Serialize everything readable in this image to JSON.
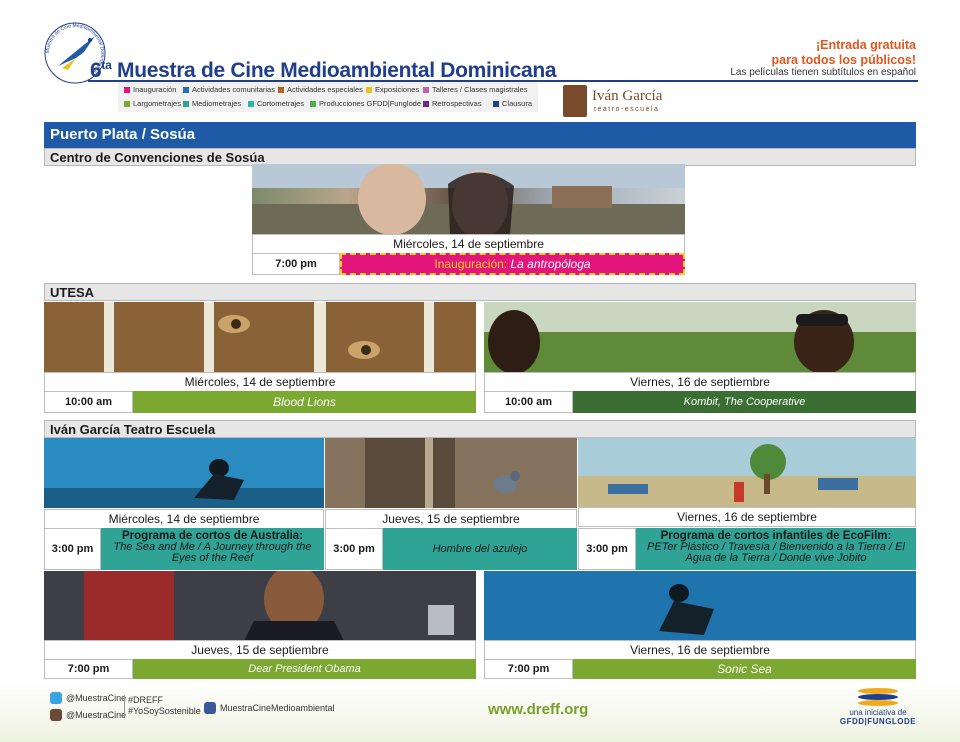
{
  "header": {
    "edition": "6",
    "edition_suffix": "ta",
    "title": "Muestra de Cine Medioambiental Dominicana",
    "logo_ring_text": "Muestra de Cine Medioambiental Dominicana",
    "free_entry_line1": "¡Entrada gratuita",
    "free_entry_line2": "para todos los públicos!",
    "subtitles_note": "Las películas tienen subtítulos en español",
    "legend": [
      {
        "label": "Inauguración",
        "color": "#e4147d"
      },
      {
        "label": "Actividades comunitarias",
        "color": "#2a6fb5"
      },
      {
        "label": "Actividades especiales",
        "color": "#b5651d"
      },
      {
        "label": "Exposiciones",
        "color": "#e8c21a"
      },
      {
        "label": "Talleres / Clases magistrales",
        "color": "#c060b0"
      },
      {
        "label": "Largometrajes",
        "color": "#7aa830"
      },
      {
        "label": "Mediometrajes",
        "color": "#2fa396"
      },
      {
        "label": "Cortometrajes",
        "color": "#27b7b0"
      },
      {
        "label": "Producciones GFDD|Funglode",
        "color": "#4db04a"
      },
      {
        "label": "Retrospectivas",
        "color": "#6a2a8a"
      },
      {
        "label": "Clausura",
        "color": "#1f3e8c"
      }
    ],
    "partner_name": "Iván García",
    "partner_sub": "teatro-escuela"
  },
  "region": {
    "title": "Puerto Plata / Sosúa"
  },
  "venues": {
    "sosua": {
      "name": "Centro de Convenciones de Sosúa",
      "event": {
        "date": "Miércoles, 14 de septiembre",
        "time": "7:00 pm",
        "label": "Inauguración:",
        "film": "La antropóloga"
      }
    },
    "utesa": {
      "name": "UTESA",
      "events": [
        {
          "date": "Miércoles, 14 de septiembre",
          "time": "10:00 am",
          "film": "Blood Lions"
        },
        {
          "date": "Viernes, 16 de septiembre",
          "time": "10:00 am",
          "film": "Kombit, The Cooperative"
        }
      ]
    },
    "ivan": {
      "name": "Iván García Teatro Escuela",
      "row1": [
        {
          "date": "Miércoles, 14 de septiembre",
          "time": "3:00 pm",
          "program": "Programa de cortos de Australia",
          "films": "The Sea and Me / A Journey through the Eyes of the Reef"
        },
        {
          "date": "Jueves, 15 de septiembre",
          "time": "3:00 pm",
          "film": "Hombre del azulejo"
        },
        {
          "date": "Viernes, 16 de septiembre",
          "time": "3:00 pm",
          "program": "Programa de cortos infantiles de EcoFilm:",
          "films": "PETer Plástico /  Travesía / Bienvenido a la Tierra /  El Agua de la Tierra / Donde vive Jobito"
        }
      ],
      "row2": [
        {
          "date": "Jueves, 15 de septiembre",
          "time": "7:00 pm",
          "film": "Dear President Obama"
        },
        {
          "date": "Viernes, 16 de septiembre",
          "time": "7:00 pm",
          "film": "Sonic Sea"
        }
      ]
    }
  },
  "footer": {
    "twitter": "@MuestraCine",
    "instagram": "@MuestraCine",
    "hashtag1": "#DREFF",
    "hashtag2": "#YoSoySostenible",
    "facebook": "MuestraCineMedioambiental",
    "url": "www.dreff.org",
    "initiative_line1": "una iniciativa de",
    "initiative_line2": "GFDD|FUNGLODE"
  }
}
